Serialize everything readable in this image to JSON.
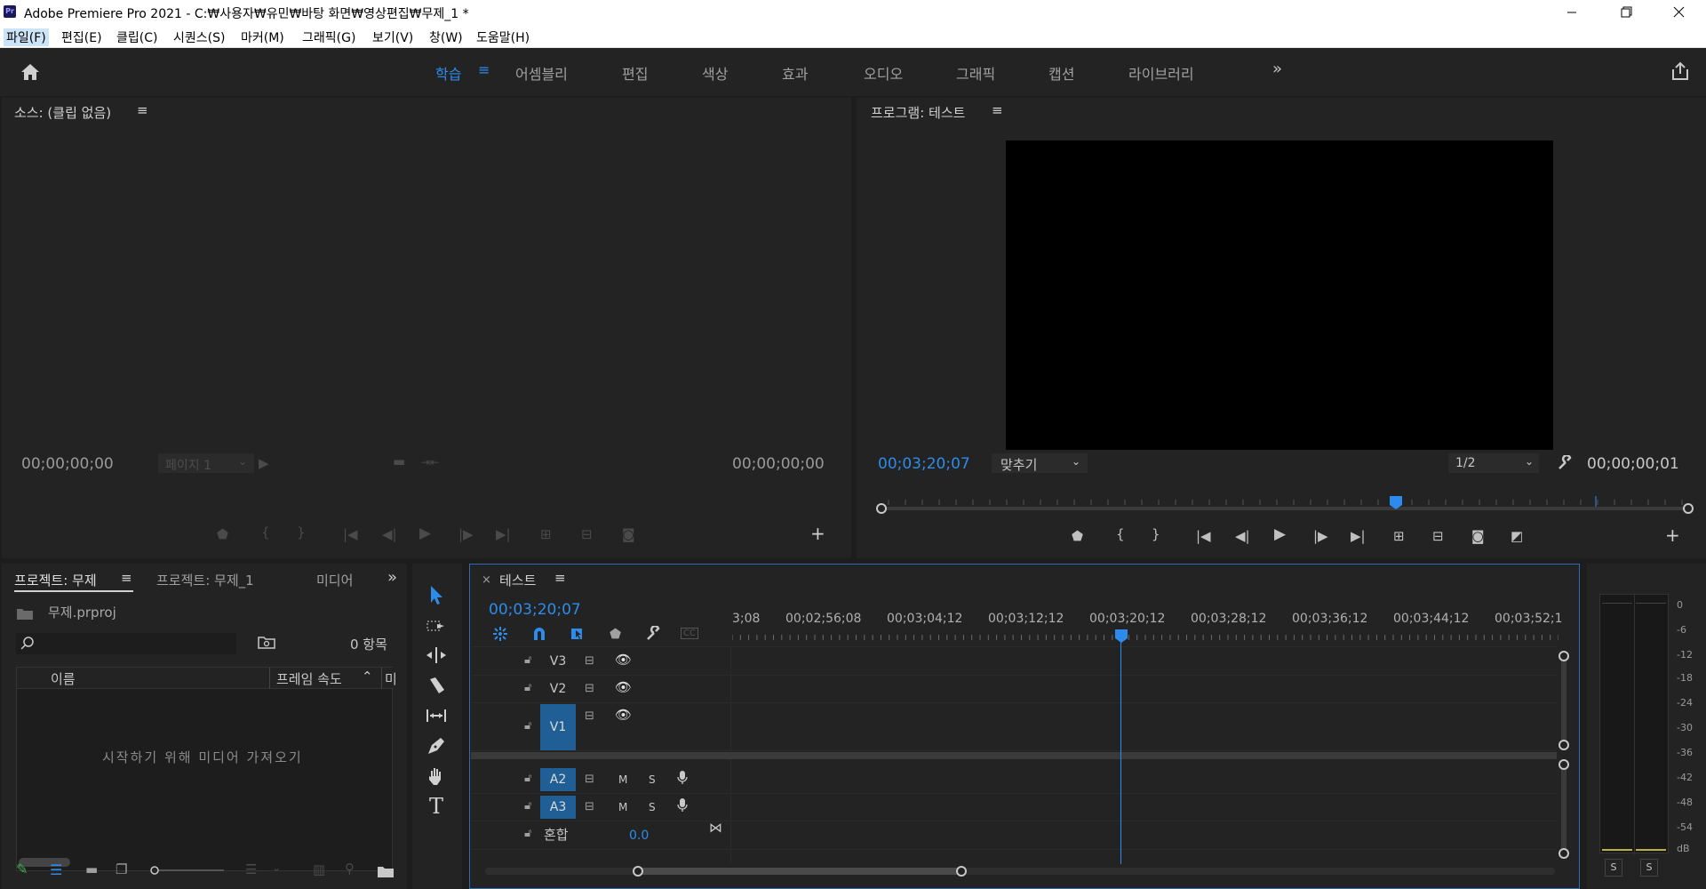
{
  "window": {
    "app_logo": "Pr",
    "title": "Adobe Premiere Pro 2021 - C:₩사용자₩유민₩바탕 화면₩영상편집₩무제_1 *",
    "controls": [
      "minimize-icon",
      "maximize-icon",
      "close-icon"
    ]
  },
  "menu": {
    "items": [
      "파일(F)",
      "편집(E)",
      "클립(C)",
      "시퀀스(S)",
      "마커(M)",
      "그래픽(G)",
      "보기(V)",
      "창(W)",
      "도움말(H)"
    ]
  },
  "workspaces": {
    "tabs": [
      "학습",
      "어셈블리",
      "편집",
      "색상",
      "효과",
      "오디오",
      "그래픽",
      "캡션",
      "라이브러리"
    ],
    "active": "학습",
    "more": "»"
  },
  "source_monitor": {
    "title": "소스: (클립 없음)",
    "timecode_in": "00;00;00;00",
    "timecode_out": "00;00;00;00",
    "page_select": "페이지 1"
  },
  "program_monitor": {
    "title": "프로그램: 테스트",
    "timecode": "00;03;20;07",
    "zoom": "맞추기",
    "resolution": "1/2",
    "duration": "00;00;00;01"
  },
  "project_panel": {
    "tabs": [
      "프로젝트: 무제",
      "프로젝트: 무제_1",
      "미디어"
    ],
    "file": "무제.prproj",
    "item_count": "0 항목",
    "columns": [
      "이름",
      "프레임 속도",
      "미"
    ],
    "empty_message": "시작하기 위해 미디어 가져오기"
  },
  "timeline": {
    "title": "테스트",
    "timecode": "00;03;20;07",
    "ruler": [
      "3;08",
      "00;02;56;08",
      "00;03;04;12",
      "00;03;12;12",
      "00;03;20;12",
      "00;03;28;12",
      "00;03;36;12",
      "00;03;44;12",
      "00;03;52;1"
    ],
    "video_tracks": [
      "V3",
      "V2",
      "V1"
    ],
    "audio_tracks": [
      "A2",
      "A3"
    ],
    "mix_label": "혼합",
    "mix_value": "0.0",
    "audio_buttons": [
      "M",
      "S"
    ]
  },
  "audio_meter": {
    "scale": [
      "0",
      "-6",
      "-12",
      "-18",
      "-24",
      "-30",
      "-36",
      "-42",
      "-48",
      "-54",
      "dB"
    ],
    "solo": [
      "S",
      "S"
    ]
  },
  "colors": {
    "accent": "#2d8ceb",
    "panel_bg": "#232323",
    "track_selected": "#1f5f96"
  }
}
